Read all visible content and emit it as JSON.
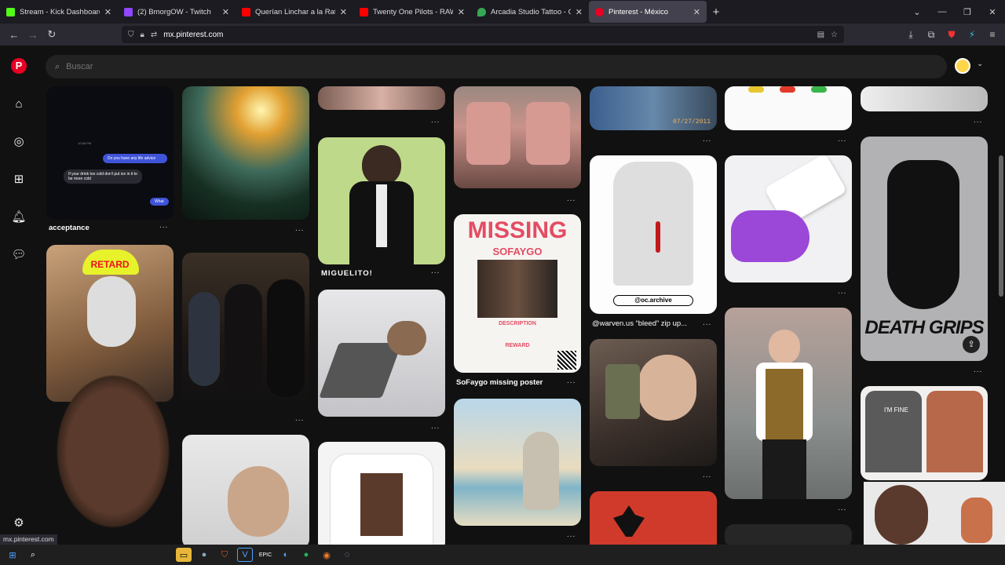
{
  "tabs": [
    {
      "title": "Stream - Kick Dashboard",
      "color": "#53fc18"
    },
    {
      "title": "(2) BmorgOW - Twitch",
      "color": "#9146ff"
    },
    {
      "title": "Querían Linchar a la Rata....| Ch",
      "color": "#ff0000"
    },
    {
      "title": "Twenty One Pilots - RAWFEAR (",
      "color": "#ff0000"
    },
    {
      "title": "Arcadia Studio Tattoo - Google",
      "color": "#34a853"
    },
    {
      "title": "Pinterest - México",
      "color": "#e60023"
    }
  ],
  "url": {
    "domain": "mx.pinterest.com"
  },
  "search": {
    "placeholder": "Buscar"
  },
  "pins": {
    "c1_1": "acceptance",
    "c3_1": "MIGUELITO!",
    "c4_1": "SoFaygo missing poster",
    "c5_1": "@warven.us “bleed” zip up...",
    "phone_msg1": "Do you have any life advice",
    "phone_msg2": "If your drink too cold don't put ice in it to be more cold",
    "phone_msg3": "What",
    "cap_retard": "RETARD",
    "missing_title": "MISSING",
    "missing_name": "SOFAYGO",
    "missing_desc": "DESCRIPTION",
    "missing_reward": "REWARD",
    "hoodie_tag": "@oc.archive",
    "death_grips": "DEATH GRIPS",
    "photo_date": "07/27/2011",
    "tee_text": "I'M FINE"
  },
  "status": {
    "link": "mx.pinterest.com"
  },
  "menu_dots": "..."
}
